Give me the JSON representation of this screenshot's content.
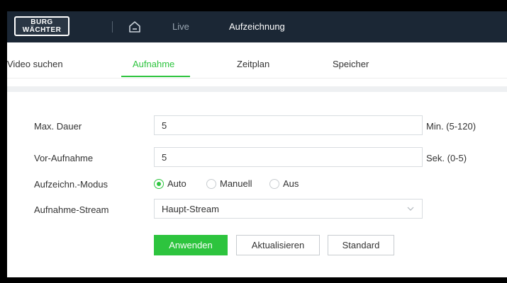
{
  "brand": {
    "line1": "BURG",
    "line2": "WÄCHTER"
  },
  "nav": {
    "home_icon": "home-icon",
    "live": "Live",
    "recording": "Aufzeichnung"
  },
  "tabs": [
    {
      "label": "Video suchen",
      "active": false
    },
    {
      "label": "Aufnahme",
      "active": true
    },
    {
      "label": "Zeitplan",
      "active": false
    },
    {
      "label": "Speicher",
      "active": false
    }
  ],
  "form": {
    "max_duration": {
      "label": "Max. Dauer",
      "value": "5",
      "hint": "Min. (5-120)"
    },
    "pre_record": {
      "label": "Vor-Aufnahme",
      "value": "5",
      "hint": "Sek. (0-5)"
    },
    "mode": {
      "label": "Aufzeichn.-Modus",
      "options": [
        {
          "label": "Auto",
          "checked": true
        },
        {
          "label": "Manuell",
          "checked": false
        },
        {
          "label": "Aus",
          "checked": false
        }
      ]
    },
    "stream": {
      "label": "Aufnahme-Stream",
      "value": "Haupt-Stream"
    }
  },
  "buttons": {
    "apply": "Anwenden",
    "refresh": "Aktualisieren",
    "default": "Standard"
  },
  "colors": {
    "accent": "#2dc43e",
    "topbar": "#1b2735"
  }
}
